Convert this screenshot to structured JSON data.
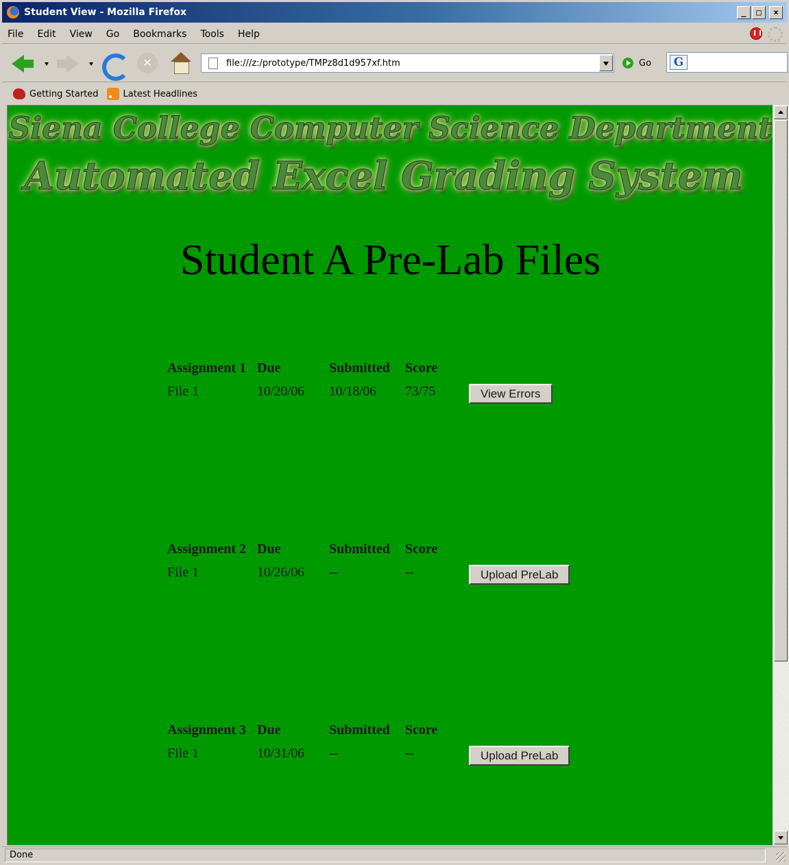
{
  "window": {
    "title": "Student View - Mozilla Firefox",
    "controls": [
      "_",
      "□",
      "×"
    ]
  },
  "menu": [
    "File",
    "Edit",
    "View",
    "Go",
    "Bookmarks",
    "Tools",
    "Help"
  ],
  "navbar": {
    "url": "file:///z:/prototype/TMPz8d1d957xf.htm",
    "go_label": "Go"
  },
  "bookmarks": [
    {
      "label": "Getting Started",
      "icon": "firefox-icon"
    },
    {
      "label": "Latest Headlines",
      "icon": "rss-icon"
    }
  ],
  "page": {
    "banner": {
      "line1": "Siena College Computer Science Department",
      "line2": "Automated Excel Grading System",
      "colors": {
        "text": "#4a8a3a",
        "glow": "#f4f7a0"
      }
    },
    "heading": "Student A Pre-Lab Files",
    "background": "#009900",
    "assignments": [
      {
        "name": "Assignment 1",
        "due_label": "Due",
        "submitted_label": "Submitted",
        "score_label": "Score",
        "file": "File 1",
        "due": "10/20/06",
        "submitted": "10/18/06",
        "score": "73/75",
        "action": "View Errors"
      },
      {
        "name": "Assignment 2",
        "due_label": "Due",
        "submitted_label": "Submitted",
        "score_label": "Score",
        "file": "File 1",
        "due": "10/26/06",
        "submitted": "--",
        "score": "--",
        "action": "Upload PreLab"
      },
      {
        "name": "Assignment 3",
        "due_label": "Due",
        "submitted_label": "Submitted",
        "score_label": "Score",
        "file": "File 1",
        "due": "10/31/06",
        "submitted": "--",
        "score": "--",
        "action": "Upload PreLab"
      }
    ]
  },
  "status": "Done"
}
